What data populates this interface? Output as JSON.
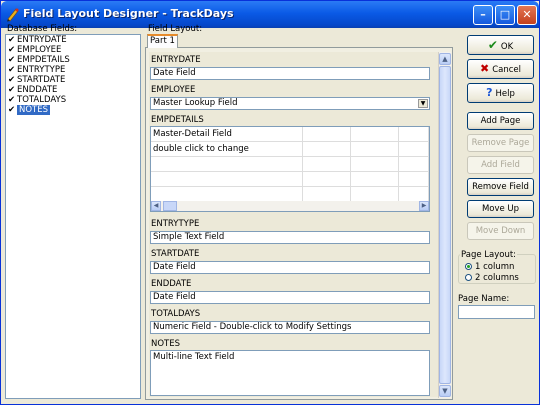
{
  "window": {
    "title": "Field Layout Designer - TrackDays",
    "controls": {
      "minimize": "–",
      "maximize": "□",
      "close": "✕"
    }
  },
  "database_fields": {
    "label": "Database Fields:",
    "items": [
      {
        "label": "ENTRYDATE",
        "checked": true,
        "selected": false
      },
      {
        "label": "EMPLOYEE",
        "checked": true,
        "selected": false
      },
      {
        "label": "EMPDETAILS",
        "checked": true,
        "selected": false
      },
      {
        "label": "ENTRYTYPE",
        "checked": true,
        "selected": false
      },
      {
        "label": "STARTDATE",
        "checked": true,
        "selected": false
      },
      {
        "label": "ENDDATE",
        "checked": true,
        "selected": false
      },
      {
        "label": "TOTALDAYS",
        "checked": true,
        "selected": false
      },
      {
        "label": "NOTES",
        "checked": true,
        "selected": true
      }
    ]
  },
  "field_layout": {
    "label": "Field Layout:",
    "tab": "Part 1",
    "fields": {
      "entrydate": {
        "label": "ENTRYDATE",
        "value": "Date Field"
      },
      "employee": {
        "label": "EMPLOYEE",
        "value": "Master Lookup Field"
      },
      "empdetails": {
        "label": "EMPDETAILS",
        "row1": "Master-Detail Field",
        "row2": "double click to change"
      },
      "entrytype": {
        "label": "ENTRYTYPE",
        "value": "Simple Text Field"
      },
      "startdate": {
        "label": "STARTDATE",
        "value": "Date Field"
      },
      "enddate": {
        "label": "ENDDATE",
        "value": "Date Field"
      },
      "totaldays": {
        "label": "TOTALDAYS",
        "value": "Numeric Field - Double-click to Modify Settings"
      },
      "notes": {
        "label": "NOTES",
        "value": "Multi-line Text Field"
      }
    }
  },
  "buttons": {
    "ok": "OK",
    "cancel": "Cancel",
    "help": "Help",
    "add_page": "Add Page",
    "remove_page": "Remove Page",
    "add_field": "Add Field",
    "remove_field": "Remove Field",
    "move_up": "Move Up",
    "move_down": "Move Down"
  },
  "page_layout": {
    "label": "Page Layout:",
    "options": [
      "1 column",
      "2 columns"
    ],
    "selected": "1 column"
  },
  "page_name": {
    "label": "Page Name:",
    "value": ""
  },
  "colors": {
    "title_bar": "#0a5ae6",
    "selection": "#316ac5",
    "ok_check": "#1a8a1a",
    "cancel_x": "#c00000",
    "help_q": "#1a56d6"
  }
}
